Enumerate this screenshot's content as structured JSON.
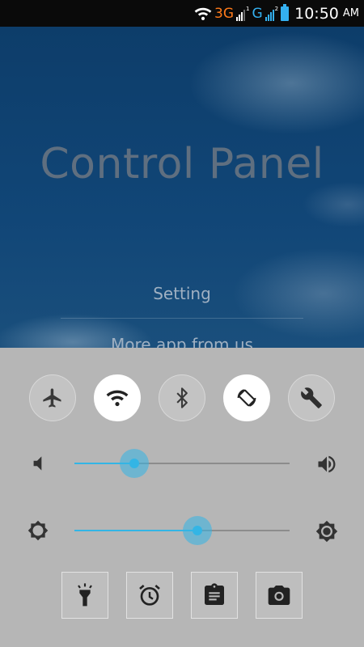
{
  "status_bar": {
    "network_3g": "3G",
    "network_g": "G",
    "sim1_label": "1",
    "sim2_label": "2",
    "time": "10:50",
    "ampm": "AM",
    "icons": [
      "wifi-icon",
      "signal-icon",
      "signal-icon",
      "battery-icon"
    ],
    "colors": {
      "net_3g": "#ff7a1a",
      "net_g": "#34b0f0",
      "battery": "#34b0f0"
    }
  },
  "app": {
    "title": "Control Panel",
    "menu": {
      "setting": "Setting",
      "more_apps": "More app from us"
    }
  },
  "control_panel": {
    "toggles": [
      {
        "icon": "airplane-icon",
        "on": false
      },
      {
        "icon": "wifi-icon",
        "on": true
      },
      {
        "icon": "bluetooth-icon",
        "on": false
      },
      {
        "icon": "auto-rotate-icon",
        "on": true
      },
      {
        "icon": "wrench-icon",
        "on": false
      }
    ],
    "volume": {
      "icon_low": "volume-low-icon",
      "icon_high": "volume-high-icon",
      "level": 0.28
    },
    "brightness": {
      "icon_low": "brightness-low-icon",
      "icon_high": "brightness-high-icon",
      "level": 0.57
    },
    "actions": [
      {
        "icon": "flashlight-icon"
      },
      {
        "icon": "alarm-clock-icon"
      },
      {
        "icon": "clipboard-icon"
      },
      {
        "icon": "camera-icon"
      }
    ],
    "colors": {
      "accent": "#33b5e5",
      "panel_bg": "#b6b6b6"
    }
  }
}
